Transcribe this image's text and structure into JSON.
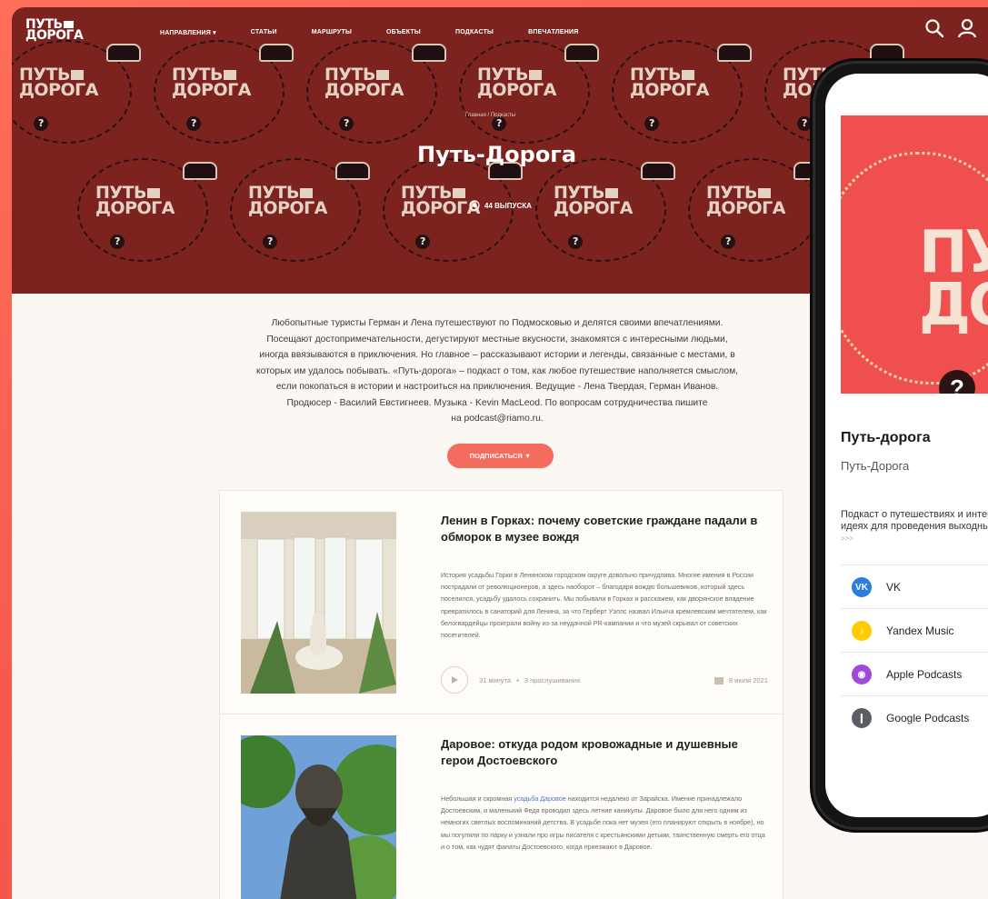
{
  "site": {
    "logo_line1": "ПУТЬ",
    "logo_line2": "ДОРОГА",
    "nav": [
      "НАПРАВЛЕНИЯ ▾",
      "СТАТЬИ",
      "МАРШРУТЫ",
      "ОБЪЕКТЫ",
      "ПОДКАСТЫ",
      "ВПЕЧАТЛЕНИЯ"
    ],
    "icons": [
      "search-icon",
      "user-icon"
    ]
  },
  "hero": {
    "breadcrumb": "Главная / Подкасты",
    "title": "Путь-Дорога",
    "episodes": "44 ВЫПУСКА",
    "pattern_line1": "ПУТЬ",
    "pattern_line2": "ДОРОГА",
    "pattern_mark": "?"
  },
  "description": [
    "Любопытные туристы Герман и Лена путешествуют по Подмосковью и делятся своими впечатлениями.",
    "Посещают достопримечательности, дегустируют местные вкусности, знакомятся с интересными людьми,",
    "иногда ввязываются в приключения. Но главное – рассказывают истории и легенды, связанные с местами, в",
    "которых им удалось побывать. «Путь-дорога» – подкаст о том, как любое путешествие наполняется смыслом,",
    "если покопаться в истории и настроиться на приключения. Ведущие - Лена Твердая, Герман Иванов.",
    "Продюсер - Василий Евстигнеев. Музыка - Kevin MacLeod. По вопросам сотрудничества пишите",
    "на podcast@riamo.ru."
  ],
  "subscribe_label": "ПОДПИСАТЬСЯ ▼",
  "episodes": [
    {
      "title": "Ленин в Горках: почему советские граждане падали в обморок в музее вождя",
      "body": "История усадьбы Горки в Ленинском городском округе довольно причудлива. Многие имения в России пострадали от революционеров, а здесь наоборот – благодаря вождю большевиков, который здесь поселился, усадьбу удалось сохранить. Мы побывали в Горках и расскажем, как дворянское владение превратилось в санаторий для Ленина, за что Герберт Уэллс назвал Ильича кремлевским мечтателем, как белогвардейцы проиграли войну из-за неудачной PR-кампании и что музей скрывал от советских посетителей.",
      "duration": "31 минута",
      "listens": "3 прослушивания",
      "date": "8 июля 2021"
    },
    {
      "title": "Даровое: откуда родом кровожадные и душевные герои Достоевского",
      "body_before": "Небольшая и скромная ",
      "body_link": "усадьба Даровое",
      "body_after": " находится недалеко от Зарайска. Имение принадлежало Достоевским, и маленький Федя проводил здесь летние каникулы. Даровое было для него одним из немногих светлых воспоминаний детства. В усадьбе пока нет музея (его планируют открыть в ноябре), но мы погуляли по парку и узнали про игры писателя с крестьянскими детьми, таинственную смерть его отца и о том, как чудят фанаты Достоевского, когда приезжают в Даровое."
    }
  ],
  "phone": {
    "cover_line1": "ПУТЬ",
    "cover_line2": "ДОРОГА",
    "cover_mark": "?",
    "title": "Путь-дорога",
    "subtitle": "Путь-Дорога",
    "desc_line1": "Подкаст о путешествиях и интересных",
    "desc_line2": "идеях для проведения выходных",
    "more": ">>>",
    "platforms": [
      {
        "label": "VK",
        "icon": "vk-icon",
        "color": "#2b7de0",
        "glyph": "VK"
      },
      {
        "label": "Yandex Music",
        "icon": "yandex-music-icon",
        "color": "#ffcc00",
        "glyph": "♪"
      },
      {
        "label": "Apple Podcasts",
        "icon": "apple-podcasts-icon",
        "color": "#a04ad9",
        "glyph": "◉"
      },
      {
        "label": "Google Podcasts",
        "icon": "google-podcasts-icon",
        "color": "#5a5f66",
        "glyph": "❙"
      }
    ]
  },
  "colors": {
    "brand": "#7c2320",
    "accent": "#f36c5d",
    "background": "#fbf8f3",
    "link": "#4d76d6"
  }
}
